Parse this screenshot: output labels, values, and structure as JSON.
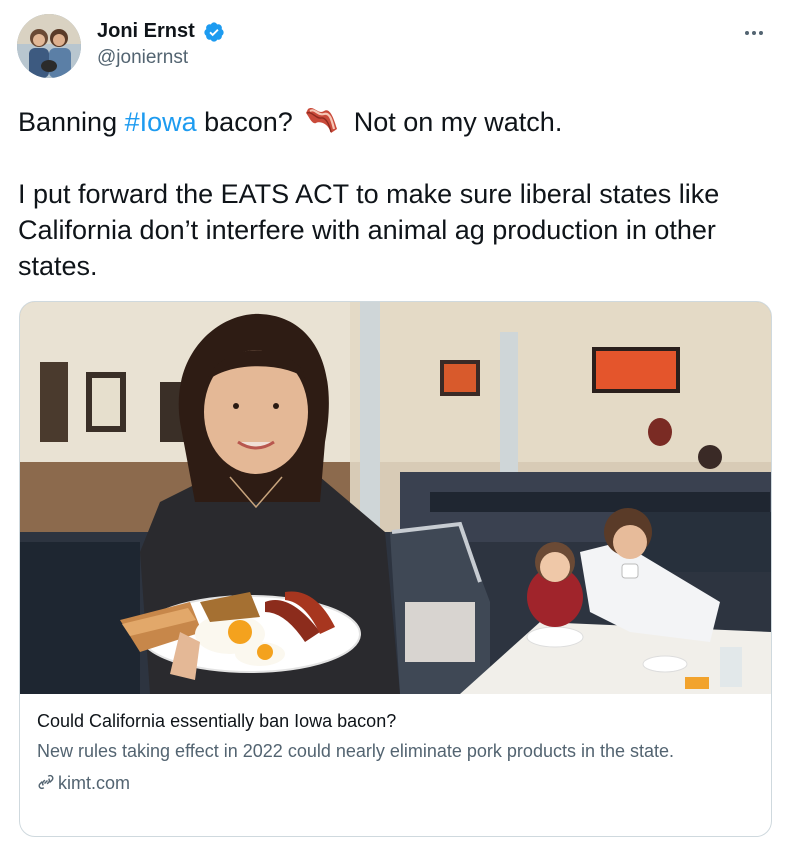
{
  "author": {
    "display_name": "Joni Ernst",
    "handle": "@joniernst",
    "verified": true
  },
  "tweet": {
    "line1_prefix": "Banning ",
    "hashtag": "#Iowa",
    "line1_mid": " bacon? ",
    "emoji_icon": "bacon-icon",
    "line1_suffix": " Not on my watch.",
    "paragraph2": "I put forward the EATS ACT to make sure liberal states like California don’t interfere with animal ag production in other states."
  },
  "card": {
    "title": "Could California essentially ban Iowa bacon?",
    "description": "New rules taking effect in 2022 could nearly eliminate pork products in the state.",
    "domain": "kimt.com"
  },
  "colors": {
    "link": "#1d9bf0",
    "secondary_text": "#536471",
    "border": "#cfd9de"
  }
}
